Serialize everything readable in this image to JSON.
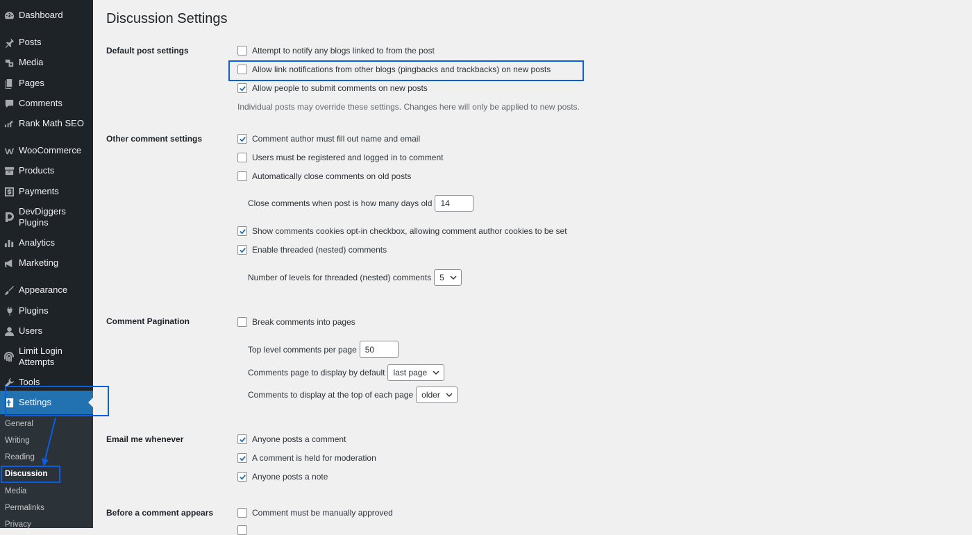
{
  "sidebar": {
    "items": [
      {
        "label": "Dashboard",
        "icon": "dashboard-icon"
      },
      {
        "label": "Posts",
        "icon": "pin-icon"
      },
      {
        "label": "Media",
        "icon": "media-icon"
      },
      {
        "label": "Pages",
        "icon": "pages-icon"
      },
      {
        "label": "Comments",
        "icon": "comment-bubble-icon"
      },
      {
        "label": "Rank Math SEO",
        "icon": "rank-math-icon"
      },
      {
        "label": "WooCommerce",
        "icon": "woocommerce-icon"
      },
      {
        "label": "Products",
        "icon": "archive-box-icon"
      },
      {
        "label": "Payments",
        "icon": "dollar-icon"
      },
      {
        "label": "DevDiggers",
        "label2": "Plugins",
        "icon": "devdiggers-icon"
      },
      {
        "label": "Analytics",
        "icon": "bar-chart-icon"
      },
      {
        "label": "Marketing",
        "icon": "megaphone-icon"
      },
      {
        "label": "Appearance",
        "icon": "paintbrush-icon"
      },
      {
        "label": "Plugins",
        "icon": "plugin-icon"
      },
      {
        "label": "Users",
        "icon": "user-icon"
      },
      {
        "label": "Limit Login",
        "label2": "Attempts",
        "icon": "fingerprint-icon"
      },
      {
        "label": "Tools",
        "icon": "wrench-icon"
      },
      {
        "label": "Settings",
        "icon": "settings-icon"
      }
    ],
    "submenu": [
      "General",
      "Writing",
      "Reading",
      "Discussion",
      "Media",
      "Permalinks",
      "Privacy"
    ]
  },
  "page": {
    "title": "Discussion Settings"
  },
  "sections": {
    "default_post": {
      "label": "Default post settings",
      "options": [
        {
          "label": "Attempt to notify any blogs linked to from the post",
          "checked": false
        },
        {
          "label": "Allow link notifications from other blogs (pingbacks and trackbacks) on new posts",
          "checked": false
        },
        {
          "label": "Allow people to submit comments on new posts",
          "checked": true
        }
      ],
      "description": "Individual posts may override these settings. Changes here will only be applied to new posts."
    },
    "other_comment": {
      "label": "Other comment settings",
      "options": [
        {
          "label": "Comment author must fill out name and email",
          "checked": true
        },
        {
          "label": "Users must be registered and logged in to comment",
          "checked": false
        },
        {
          "label": "Automatically close comments on old posts",
          "checked": false
        },
        {
          "label": "Show comments cookies opt-in checkbox, allowing comment author cookies to be set",
          "checked": true
        },
        {
          "label": "Enable threaded (nested) comments",
          "checked": true
        }
      ],
      "close_days_label": "Close comments when post is how many days old",
      "close_days_value": "14",
      "thread_levels_label": "Number of levels for threaded (nested) comments",
      "thread_levels_value": "5"
    },
    "pagination": {
      "label": "Comment Pagination",
      "break_label": "Break comments into pages",
      "break_checked": false,
      "per_page_label": "Top level comments per page",
      "per_page_value": "50",
      "default_page_label": "Comments page to display by default",
      "default_page_value": "last page",
      "top_label": "Comments to display at the top of each page",
      "top_value": "older"
    },
    "email": {
      "label": "Email me whenever",
      "options": [
        {
          "label": "Anyone posts a comment",
          "checked": true
        },
        {
          "label": "A comment is held for moderation",
          "checked": true
        },
        {
          "label": "Anyone posts a note",
          "checked": true
        }
      ]
    },
    "before_appears": {
      "label": "Before a comment appears",
      "options": [
        {
          "label": "Comment must be manually approved",
          "checked": false
        }
      ]
    }
  },
  "colors": {
    "accent": "#2271b1",
    "highlight": "#0a5ee6",
    "sidebar": "#1d2327"
  }
}
